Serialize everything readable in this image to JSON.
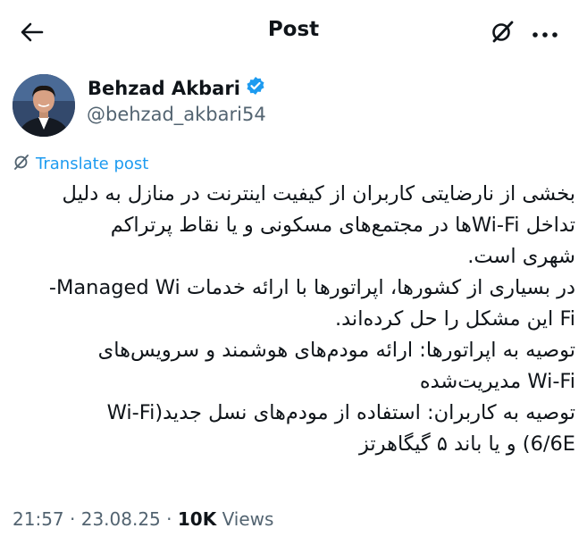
{
  "header": {
    "title": "Post",
    "back_icon": "arrow-left-icon",
    "grok_icon": "grok-icon",
    "more_icon": "more-horizontal-icon"
  },
  "author": {
    "name": "Behzad Akbari",
    "handle": "@behzad_akbari54",
    "verified": true,
    "verified_color": "#1d9bf0"
  },
  "translate": {
    "label": "Translate post",
    "icon": "translate-icon"
  },
  "tweet": {
    "lines": [
      "بخشی از نارضایتی کاربران از کیفیت اینترنت در منازل به دلیل",
      "تداخل Wi-Fiها در مجتمع‌های مسکونی و یا نقاط پرتراکم",
      "شهری است.",
      "در بسیاری از کشورها، اپراتورها با ارائه خدمات Managed Wi-",
      "Fi این مشکل را حل کرده‌اند.",
      "توصیه به اپراتورها: ارائه مودم‌های هوشمند و سرویس‌های",
      "Wi-Fi مدیریت‌شده",
      "توصیه به کاربران: استفاده از مودم‌های نسل جدید(Wi-Fi",
      "6/6E) و یا باند ۵ گیگاهرتز"
    ]
  },
  "meta": {
    "time": "21:57",
    "date": "23.08.25",
    "views_count": "10K",
    "views_label": "Views"
  },
  "colors": {
    "accent": "#1d9bf0",
    "text": "#0f1419",
    "secondary": "#536471"
  }
}
